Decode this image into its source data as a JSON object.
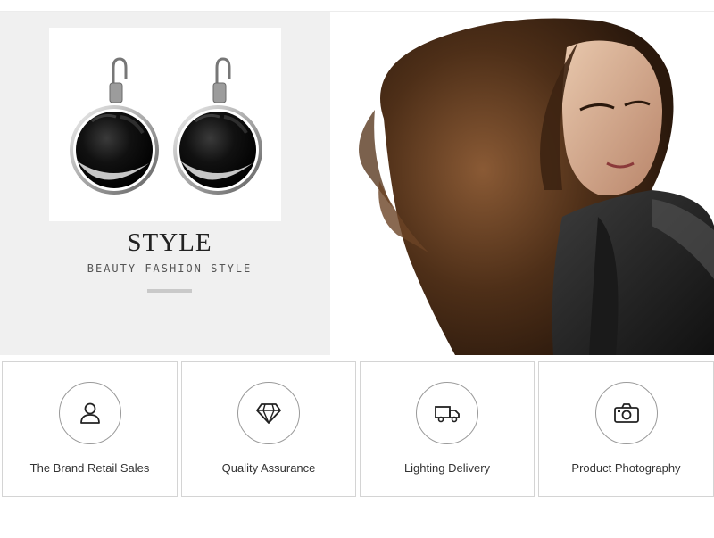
{
  "hero": {
    "title": "STYLE",
    "subtitle": "BEAUTY FASHION STYLE"
  },
  "features": [
    {
      "label": "The Brand Retail Sales",
      "icon": "user-icon"
    },
    {
      "label": "Quality Assurance",
      "icon": "diamond-icon"
    },
    {
      "label": "Lighting Delivery",
      "icon": "truck-icon"
    },
    {
      "label": "Product Photography",
      "icon": "camera-icon"
    }
  ],
  "colors": {
    "panel_bg": "#f0f0f0",
    "earring_black": "#0d0d0d",
    "border": "#d4d4d4"
  }
}
